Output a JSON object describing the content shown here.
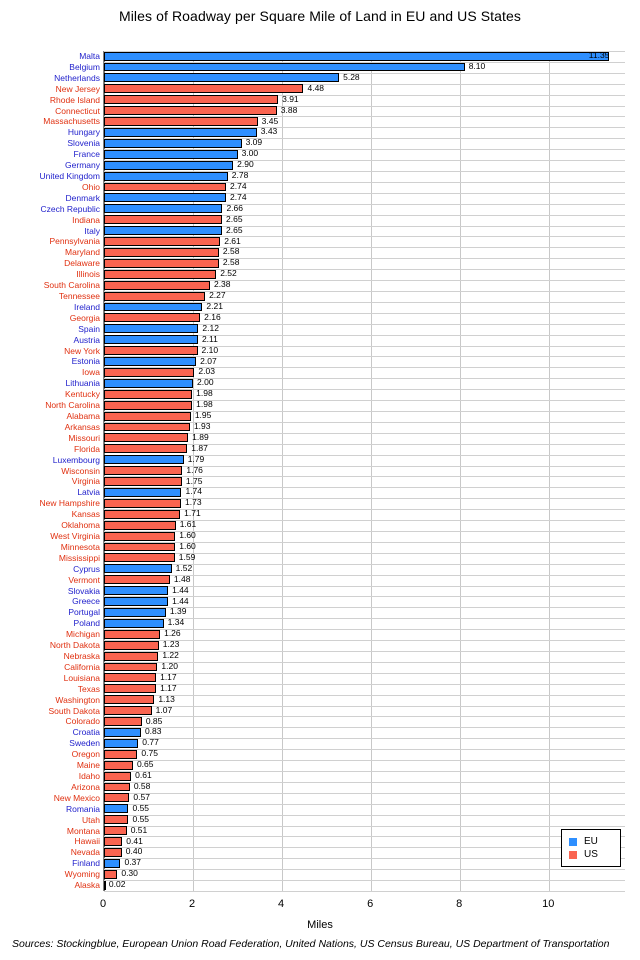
{
  "chart_data": {
    "type": "bar",
    "orientation": "horizontal",
    "title": "Miles of Roadway per Square Mile of Land in EU and US States",
    "xlabel": "Miles",
    "ylabel": "",
    "xlim": [
      0,
      11.7
    ],
    "xticks": [
      0,
      2,
      4,
      6,
      8,
      10
    ],
    "xtick_labels": [
      "0",
      "2",
      "4",
      "6",
      "8",
      "10"
    ],
    "grid": true,
    "legend_position": "bottom-right",
    "legend": [
      {
        "label": "EU",
        "color": "#2e8fff"
      },
      {
        "label": "US",
        "color": "#fa6450"
      }
    ],
    "colors": {
      "eu": "#2e8fff",
      "us": "#fa6450",
      "eu_label": "#2222cc",
      "us_label": "#e03010",
      "grid": "#c8c8c8",
      "axis": "#6e6e6e",
      "background": "#ffffff"
    },
    "categories": [
      "Malta",
      "Belgium",
      "Netherlands",
      "New Jersey",
      "Rhode Island",
      "Connecticut",
      "Massachusetts",
      "Hungary",
      "Slovenia",
      "France",
      "Germany",
      "United Kingdom",
      "Ohio",
      "Denmark",
      "Czech Republic",
      "Indiana",
      "Italy",
      "Pennsylvania",
      "Maryland",
      "Delaware",
      "Illinois",
      "South Carolina",
      "Tennessee",
      "Ireland",
      "Georgia",
      "Spain",
      "Austria",
      "New York",
      "Estonia",
      "Iowa",
      "Lithuania",
      "Kentucky",
      "North Carolina",
      "Alabama",
      "Arkansas",
      "Missouri",
      "Florida",
      "Luxembourg",
      "Wisconsin",
      "Virginia",
      "Latvia",
      "New Hampshire",
      "Kansas",
      "Oklahoma",
      "West Virginia",
      "Minnesota",
      "Mississippi",
      "Cyprus",
      "Vermont",
      "Slovakia",
      "Greece",
      "Portugal",
      "Poland",
      "Michigan",
      "North Dakota",
      "Nebraska",
      "California",
      "Louisiana",
      "Texas",
      "Washington",
      "South Dakota",
      "Colorado",
      "Croatia",
      "Sweden",
      "Oregon",
      "Maine",
      "Idaho",
      "Arizona",
      "New Mexico",
      "Romania",
      "Utah",
      "Montana",
      "Hawaii",
      "Nevada",
      "Finland",
      "Wyoming",
      "Alaska"
    ],
    "values": [
      11.35,
      8.1,
      5.28,
      4.48,
      3.91,
      3.88,
      3.45,
      3.43,
      3.09,
      3.0,
      2.9,
      2.78,
      2.74,
      2.74,
      2.66,
      2.65,
      2.65,
      2.61,
      2.58,
      2.58,
      2.52,
      2.38,
      2.27,
      2.21,
      2.16,
      2.12,
      2.11,
      2.1,
      2.07,
      2.03,
      2.0,
      1.98,
      1.98,
      1.95,
      1.93,
      1.89,
      1.87,
      1.79,
      1.76,
      1.75,
      1.74,
      1.73,
      1.71,
      1.61,
      1.6,
      1.6,
      1.59,
      1.52,
      1.48,
      1.44,
      1.44,
      1.39,
      1.34,
      1.26,
      1.23,
      1.22,
      1.2,
      1.17,
      1.17,
      1.13,
      1.07,
      0.85,
      0.83,
      0.77,
      0.75,
      0.65,
      0.61,
      0.58,
      0.57,
      0.55,
      0.55,
      0.51,
      0.41,
      0.4,
      0.37,
      0.3,
      0.02
    ],
    "value_labels": [
      "11.35",
      "8.10",
      "5.28",
      "4.48",
      "3.91",
      "3.88",
      "3.45",
      "3.43",
      "3.09",
      "3.00",
      "2.90",
      "2.78",
      "2.74",
      "2.74",
      "2.66",
      "2.65",
      "2.65",
      "2.61",
      "2.58",
      "2.58",
      "2.52",
      "2.38",
      "2.27",
      "2.21",
      "2.16",
      "2.12",
      "2.11",
      "2.10",
      "2.07",
      "2.03",
      "2.00",
      "1.98",
      "1.98",
      "1.95",
      "1.93",
      "1.89",
      "1.87",
      "1.79",
      "1.76",
      "1.75",
      "1.74",
      "1.73",
      "1.71",
      "1.61",
      "1.60",
      "1.60",
      "1.59",
      "1.52",
      "1.48",
      "1.44",
      "1.44",
      "1.39",
      "1.34",
      "1.26",
      "1.23",
      "1.22",
      "1.20",
      "1.17",
      "1.17",
      "1.13",
      "1.07",
      "0.85",
      "0.83",
      "0.77",
      "0.75",
      "0.65",
      "0.61",
      "0.58",
      "0.57",
      "0.55",
      "0.55",
      "0.51",
      "0.41",
      "0.40",
      "0.37",
      "0.30",
      "0.02"
    ],
    "groups": [
      "EU",
      "EU",
      "EU",
      "US",
      "US",
      "US",
      "US",
      "EU",
      "EU",
      "EU",
      "EU",
      "EU",
      "US",
      "EU",
      "EU",
      "US",
      "EU",
      "US",
      "US",
      "US",
      "US",
      "US",
      "US",
      "EU",
      "US",
      "EU",
      "EU",
      "US",
      "EU",
      "US",
      "EU",
      "US",
      "US",
      "US",
      "US",
      "US",
      "US",
      "EU",
      "US",
      "US",
      "EU",
      "US",
      "US",
      "US",
      "US",
      "US",
      "US",
      "EU",
      "US",
      "EU",
      "EU",
      "EU",
      "EU",
      "US",
      "US",
      "US",
      "US",
      "US",
      "US",
      "US",
      "US",
      "US",
      "EU",
      "EU",
      "US",
      "US",
      "US",
      "US",
      "US",
      "EU",
      "US",
      "US",
      "US",
      "US",
      "EU",
      "US",
      "US"
    ]
  },
  "footer": {
    "sources": "Sources: Stockingblue, European Union Road Federation, United Nations, US Census Bureau, US Department of Transportation"
  }
}
